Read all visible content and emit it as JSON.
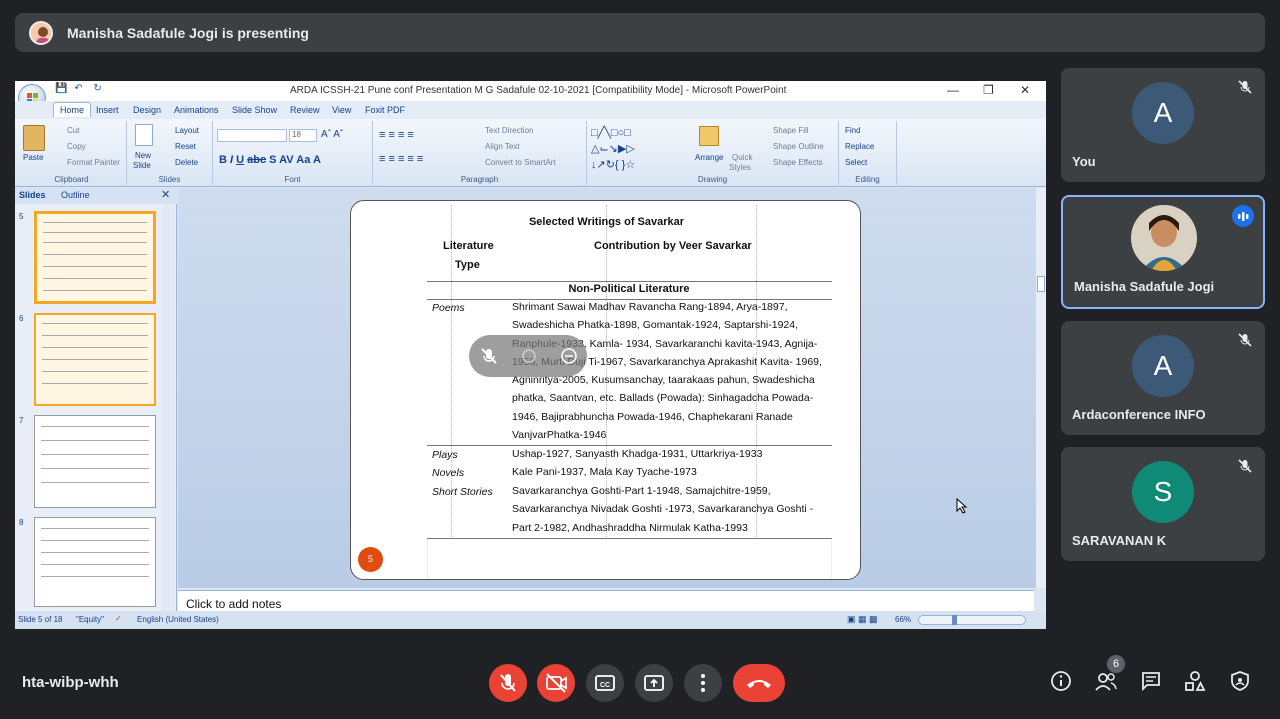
{
  "presenting_banner": {
    "text": "Manisha Sadafule Jogi is presenting"
  },
  "ppt": {
    "title": "ARDA ICSSH-21 Pune  conf Presentation M G Sadafule 02-10-2021 [Compatibility Mode] - Microsoft PowerPoint",
    "tabs": [
      "Home",
      "Insert",
      "Design",
      "Animations",
      "Slide Show",
      "Review",
      "View",
      "Foxit PDF"
    ],
    "groups": {
      "clipboard": {
        "label": "Clipboard",
        "paste": "Paste",
        "cut": "Cut",
        "copy": "Copy",
        "format_painter": "Format Painter"
      },
      "slides": {
        "label": "Slides",
        "new_slide": "New",
        "new_slide2": "Slide",
        "layout": "Layout",
        "reset": "Reset",
        "delete": "Delete"
      },
      "font": {
        "label": "Font",
        "size": "18"
      },
      "paragraph": {
        "label": "Paragraph",
        "text_direction": "Text Direction",
        "align_text": "Align Text",
        "smartart": "Convert to SmartArt"
      },
      "drawing": {
        "label": "Drawing",
        "arrange": "Arrange",
        "quick_styles": "Quick",
        "quick_styles2": "Styles",
        "shape_fill": "Shape Fill",
        "shape_outline": "Shape Outline",
        "shape_effects": "Shape Effects"
      },
      "editing": {
        "label": "Editing",
        "find": "Find",
        "replace": "Replace",
        "select": "Select"
      }
    },
    "left_pane": {
      "tab_slides": "Slides",
      "tab_outline": "Outline",
      "thumb_numbers": [
        "5",
        "6",
        "7",
        "8"
      ]
    },
    "slide": {
      "title": "Selected Writings of Savarkar",
      "col1_header_a": "Literature",
      "col1_header_b": "Type",
      "col2_header": "Contribution by Veer Savarkar",
      "section": "Non-Political Literature",
      "rows": [
        {
          "type": "Poems",
          "lines": [
            "Shrimant Sawai Madhav Ravancha Rang-1894, Arya-1897,",
            "Swadeshicha Phatka-1898, Gomantak-1924, Saptarshi-1924,",
            "Ranphule-1933, Kamla- 1934, Savarkaranchi kavita-1943, Agnija-",
            "1956, Murti Duji Ti-1967, Savarkaranchya Aprakashit Kavita- 1969,",
            "Agninritya-2005, Kusumsanchay, taarakaas pahun, Swadeshicha",
            "phatka, Saantvan, etc. Ballads (Powada): Sinhagadcha Powada-",
            "1946, Bajiprabhuncha Powada-1946, Chaphekarani Ranade",
            "VanjvarPhatka-1946"
          ]
        },
        {
          "type": "Plays",
          "lines": [
            "Ushap-1927, Sanyasth Khadga-1931, Uttarkriya-1933"
          ]
        },
        {
          "type": "Novels",
          "lines": [
            "Kale Pani-1937,  Mala Kay Tyache-1973"
          ]
        },
        {
          "type": "Short Stories",
          "lines": [
            "Savarkaranchya Goshti-Part 1-1948, Samajchitre-1959,",
            "Savarkaranchya Nivadak Goshti -1973, Savarkaranchya Goshti -",
            "Part 2-1982, Andhashraddha Nirmulak Katha-1993"
          ]
        }
      ],
      "page_number": "5"
    },
    "notes_placeholder": "Click to add notes",
    "status": {
      "slide": "Slide 5 of 18",
      "theme": "\"Equity\"",
      "language": "English (United States)",
      "zoom": "66%"
    }
  },
  "participants": [
    {
      "name": "You",
      "initial": "A",
      "color": "#3c5a78",
      "muted": true
    },
    {
      "name": "Manisha Sadafule Jogi",
      "initial": "",
      "color": "#6b5e4a",
      "muted": false,
      "speaking": true
    },
    {
      "name": "Ardaconference INFO",
      "initial": "A",
      "color": "#3c5a78",
      "muted": true
    },
    {
      "name": "SARAVANAN K",
      "initial": "S",
      "color": "#0f8a76",
      "muted": true
    }
  ],
  "meeting_code": "hta-wibp-whh",
  "people_count": "6",
  "colors": {
    "red": "#ea4335",
    "bg": "#202124",
    "tile": "#3c4043",
    "accent": "#8ab4f8"
  }
}
